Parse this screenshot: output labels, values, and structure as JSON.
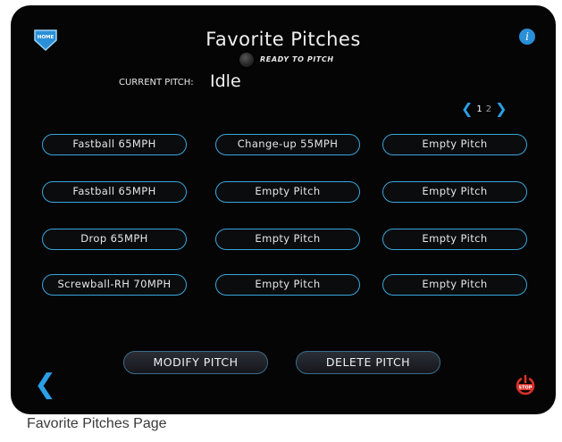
{
  "header": {
    "home_label": "HOME",
    "title": "Favorite Pitches",
    "status": "READY TO PITCH"
  },
  "current_pitch": {
    "label": "CURRENT PITCH:",
    "value": "Idle"
  },
  "pager": {
    "current_page": "1",
    "other_page": "2"
  },
  "pitches": [
    "Fastball 65MPH",
    "Change-up 55MPH",
    "Empty Pitch",
    "Fastball 65MPH",
    "Empty Pitch",
    "Empty Pitch",
    "Drop 65MPH",
    "Empty Pitch",
    "Empty Pitch",
    "Screwball-RH 70MPH",
    "Empty Pitch",
    "Empty Pitch"
  ],
  "actions": {
    "modify": "MODIFY PITCH",
    "delete": "DELETE PITCH"
  },
  "footer": {
    "stop_label": "STOP"
  },
  "caption": "Favorite Pitches Page",
  "icons": {
    "home": "home-icon",
    "info": "info-icon",
    "back": "back-chevron-icon",
    "stop": "stop-power-icon"
  },
  "colors": {
    "accent": "#2aa0e6",
    "button_border": "#3aa6dc",
    "stop": "#d9302a"
  }
}
